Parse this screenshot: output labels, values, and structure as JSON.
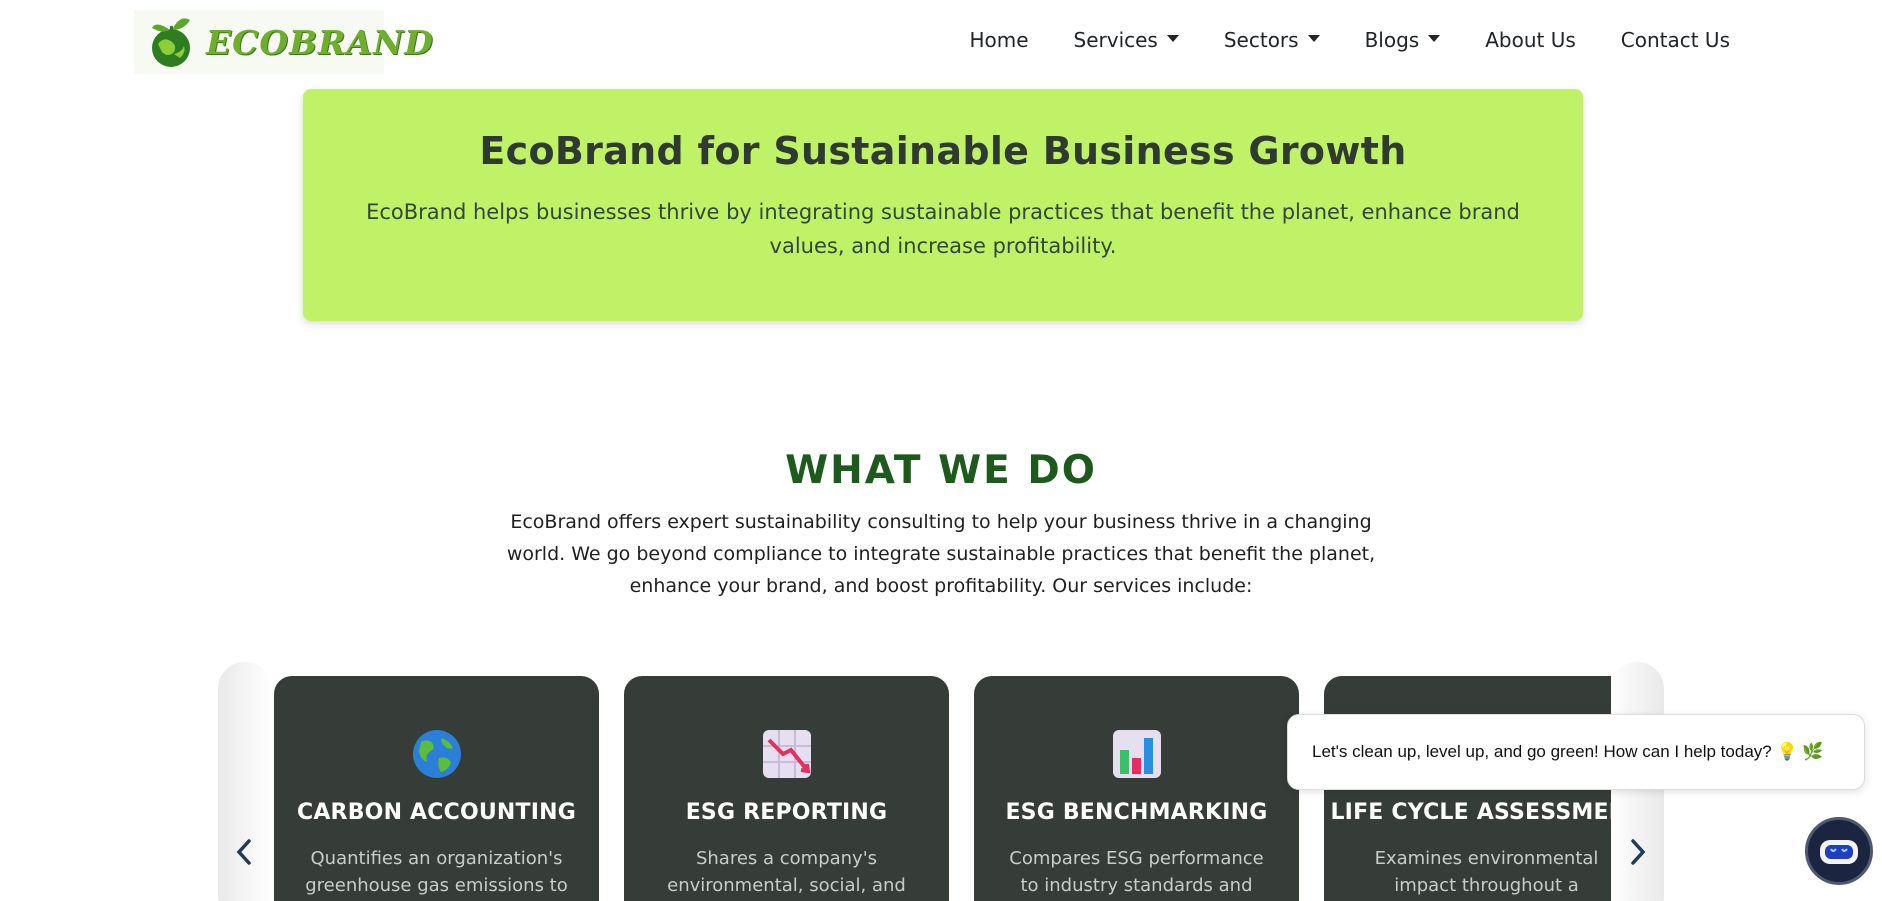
{
  "brand": {
    "name": "ECOBRAND"
  },
  "nav": {
    "items": [
      {
        "label": "Home",
        "dropdown": false
      },
      {
        "label": "Services",
        "dropdown": true
      },
      {
        "label": "Sectors",
        "dropdown": true
      },
      {
        "label": "Blogs",
        "dropdown": true
      },
      {
        "label": "About Us",
        "dropdown": false
      },
      {
        "label": "Contact Us",
        "dropdown": false
      }
    ]
  },
  "hero": {
    "title": "EcoBrand for Sustainable Business Growth",
    "text": "EcoBrand helps businesses thrive by integrating sustainable practices that benefit the planet, enhance brand values, and increase profitability."
  },
  "what_we_do": {
    "title": "WHAT WE DO",
    "text": "EcoBrand offers expert sustainability consulting to help your business thrive in a changing world. We go beyond compliance to integrate sustainable practices that benefit the planet, enhance your brand, and boost profitability. Our services include:"
  },
  "services": [
    {
      "icon": "globe-icon",
      "title": "CARBON ACCOUNTING",
      "desc": "Quantifies an organization's greenhouse gas emissions to"
    },
    {
      "icon": "chart-decreasing-icon",
      "title": "ESG REPORTING",
      "desc": "Shares a company's environmental, social, and"
    },
    {
      "icon": "bar-chart-icon",
      "title": "ESG BENCHMARKING",
      "desc": "Compares ESG performance to industry standards and"
    },
    {
      "icon": "recycle-icon",
      "title": "LIFE CYCLE ASSESSMENT",
      "desc": "Examines environmental impact throughout a product's full life"
    }
  ],
  "chat": {
    "message": "Let's clean up, level up, and go green! How can I help today? 💡 🌿"
  },
  "colors": {
    "hero_bg": "#bff267",
    "heading_green": "#1e5a1d",
    "card_bg": "#363c37"
  }
}
